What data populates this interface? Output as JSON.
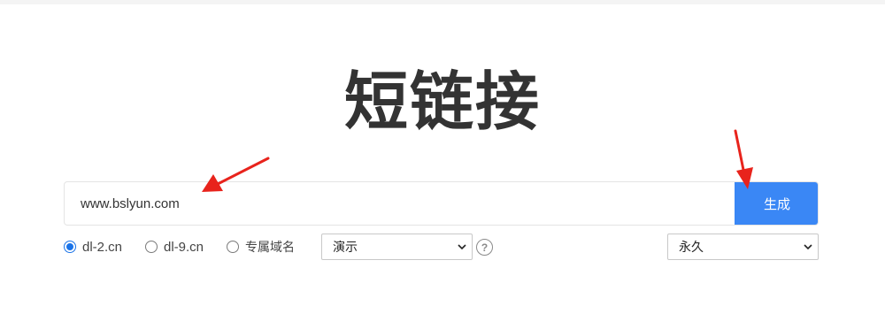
{
  "page": {
    "title": "短链接"
  },
  "search": {
    "url_value": "www.bslyun.com",
    "generate_label": "生成"
  },
  "domains": {
    "options": [
      {
        "label": "dl-2.cn",
        "checked": true
      },
      {
        "label": "dl-9.cn",
        "checked": false
      },
      {
        "label": "专属域名",
        "checked": false
      }
    ]
  },
  "selects": {
    "template_value": "演示",
    "expiry_value": "永久"
  },
  "icons": {
    "help": "help-question-icon",
    "dropdown": "chevron-down-icon"
  },
  "colors": {
    "accent": "#3a87f5",
    "radio_checked": "#1a73e8",
    "annotation_arrow": "#e8231c"
  }
}
